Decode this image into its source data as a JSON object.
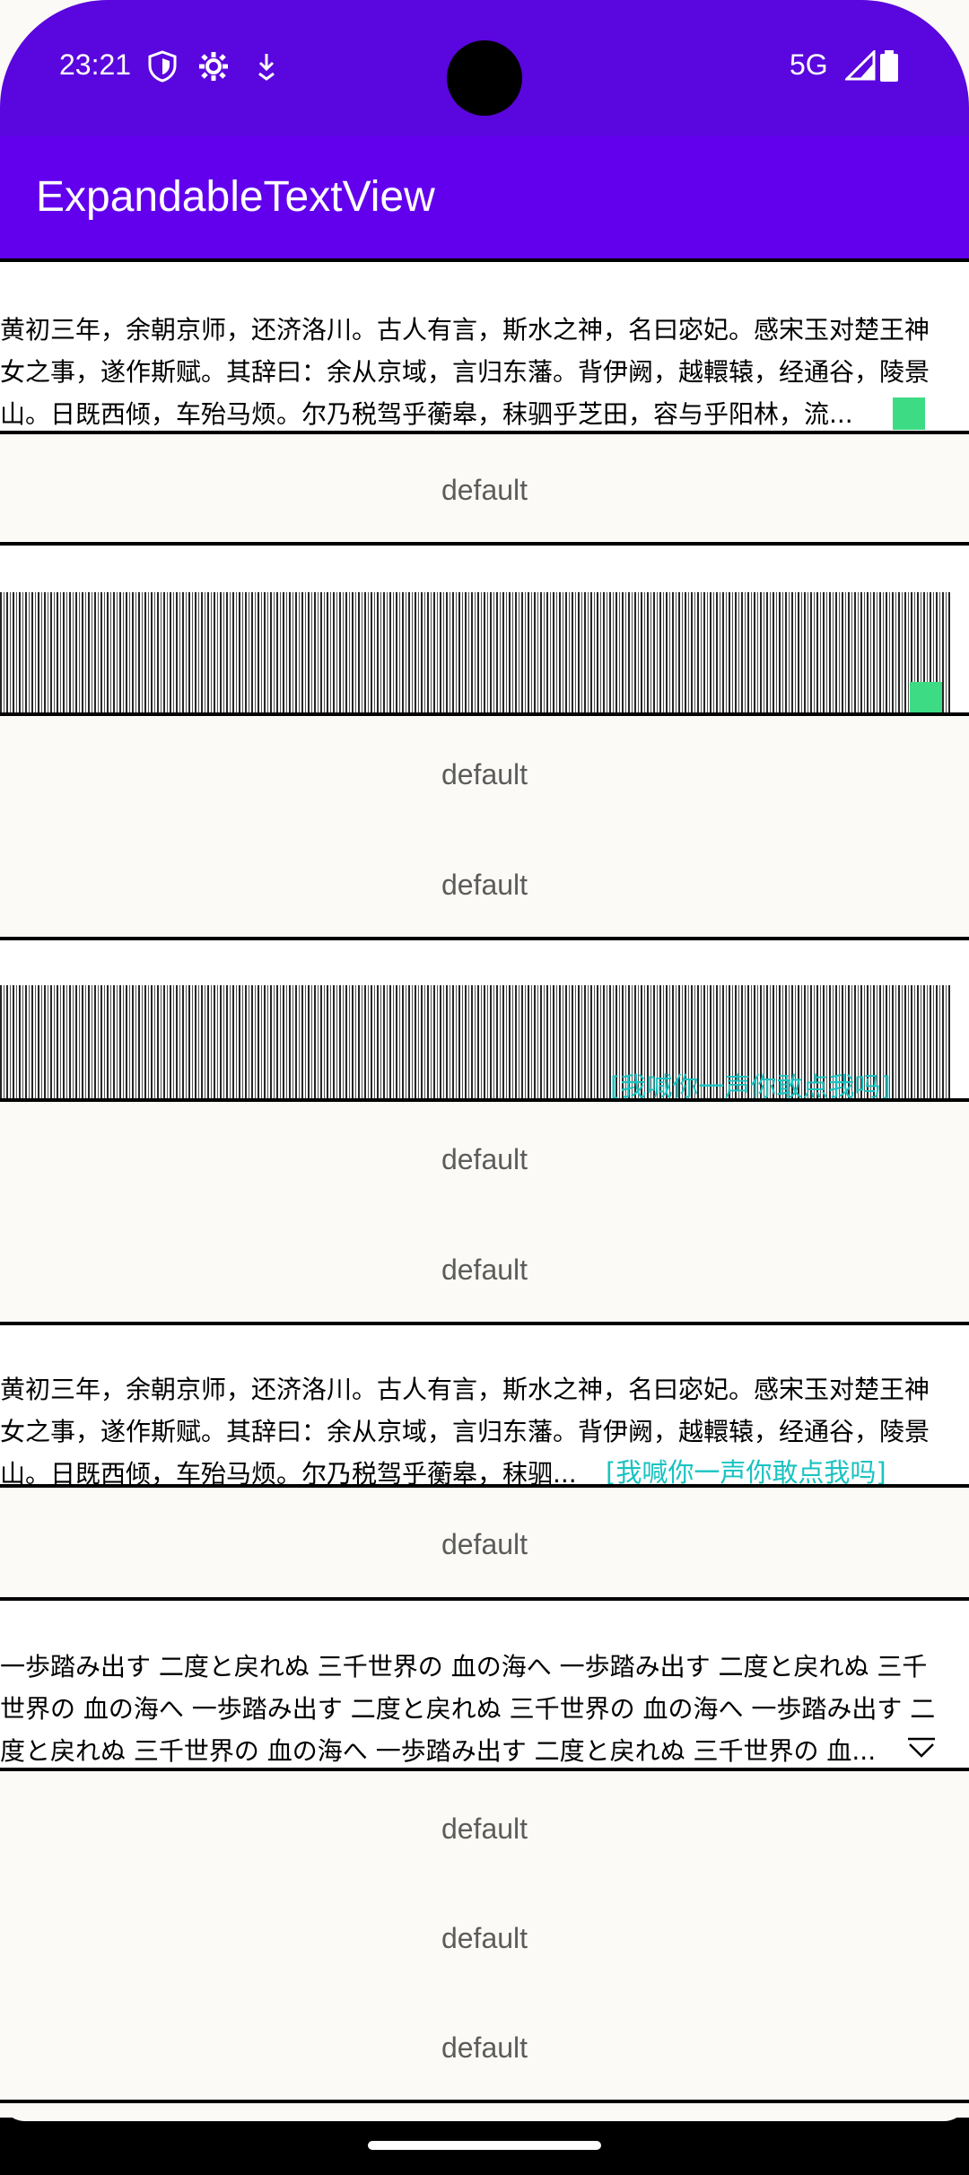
{
  "status": {
    "time": "23:21",
    "network": "5G",
    "icons": [
      "shield-icon",
      "gear-icon",
      "download-icon",
      "signal-icon",
      "battery-icon"
    ]
  },
  "app": {
    "title": "ExpandableTextView"
  },
  "block1": {
    "lines": [
      "黄初三年，余朝京师，还济洛川。古人有言，斯水之神，名曰宓妃。感宋玉对楚王神",
      "女之事，遂作斯赋。其辞曰：余从京域，言归东藩。背伊阙，越轘辕，经通谷，陵景",
      "山。日既西倾，车殆马烦。尔乃税驾乎蘅皋，秣驷乎芝田，容与乎阳林，流..."
    ]
  },
  "defaults": {
    "label": "default"
  },
  "block4": {
    "lines": [
      "黄初三年，余朝京师，还济洛川。古人有言，斯水之神，名曰宓妃。感宋玉对楚王神",
      "女之事，遂作斯赋。其辞曰：余从京域，言归东藩。背伊阙，越轘辕，经通谷，陵景",
      "山。日既西倾，车殆马烦。尔乃税驾乎蘅皋，秣驷..."
    ],
    "expand_link": "[我喊你一声你敢点我吗]"
  },
  "block3": {
    "expand_link": "[我喊你一声你敢点我吗]"
  },
  "block5": {
    "lines": [
      "一歩踏み出す 二度と戻れぬ 三千世界の 血の海へ 一歩踏み出す 二度と戻れぬ 三千",
      "世界の 血の海へ 一歩踏み出す 二度と戻れぬ 三千世界の 血の海へ 一歩踏み出す 二",
      "度と戻れぬ 三千世界の 血の海へ 一歩踏み出す 二度と戻れぬ 三千世界の 血..."
    ]
  },
  "colors": {
    "status_bar": "#5a06de",
    "toolbar": "#6200ee",
    "expand_button": "#3ddc84",
    "link": "#19c3c1"
  }
}
